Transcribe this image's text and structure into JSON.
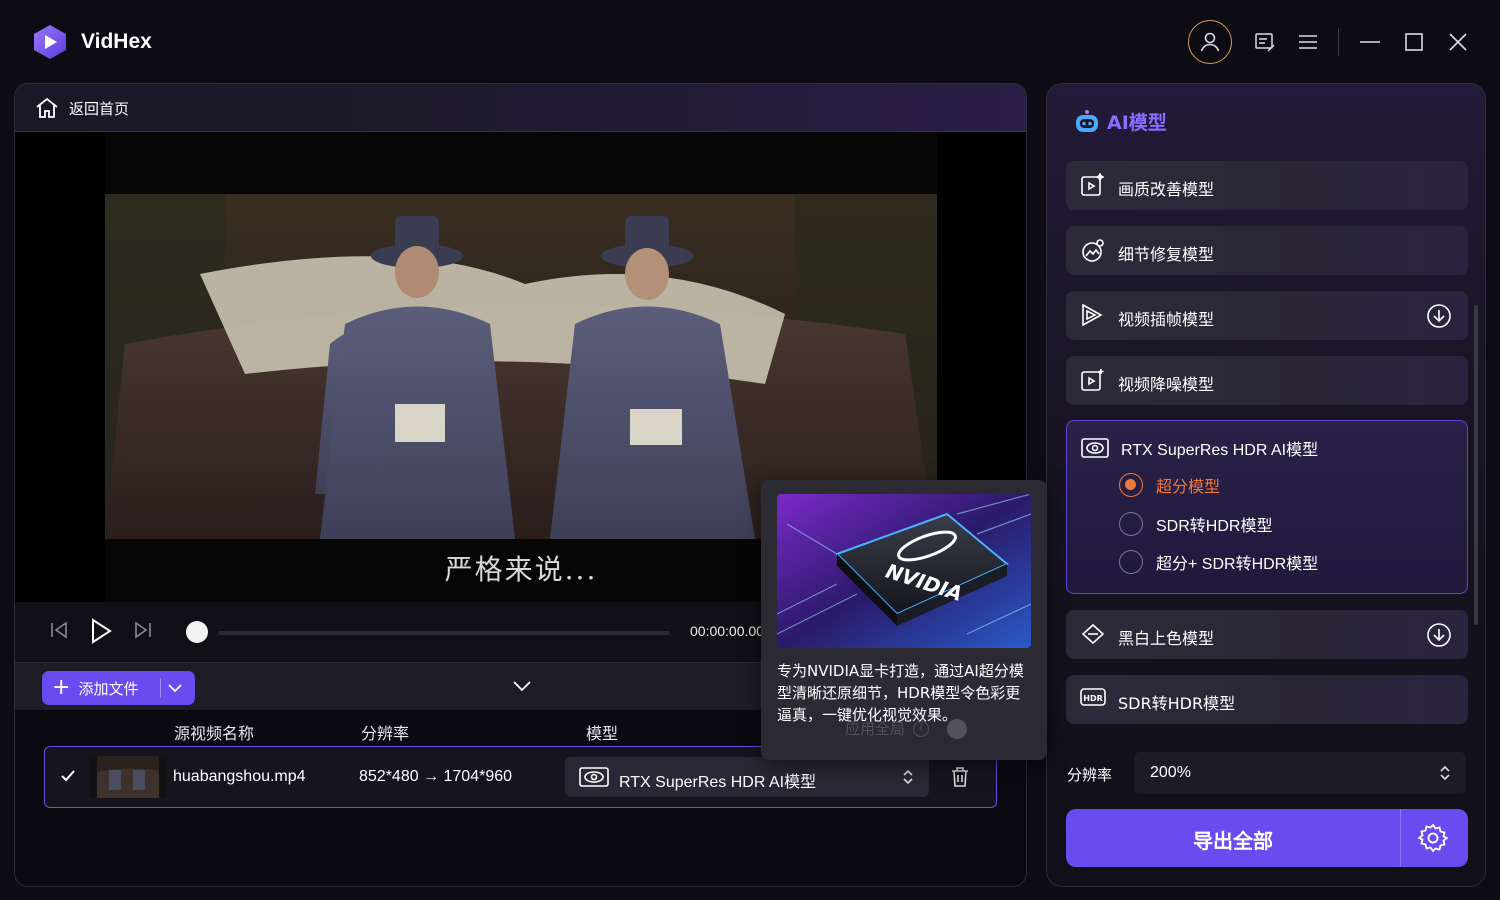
{
  "app": {
    "name": "VidHex"
  },
  "nav": {
    "home_label": "返回首页"
  },
  "video": {
    "subtitle": "严格来说...",
    "time": "00:00:00.00"
  },
  "toolbar": {
    "add_file_label": "添加文件"
  },
  "table": {
    "headers": {
      "name": "源视频名称",
      "resolution": "分辨率",
      "model": "模型"
    },
    "rows": [
      {
        "name": "huabangshou.mp4",
        "resolution": "852*480 → 1704*960",
        "model": "RTX SuperRes HDR AI模型"
      }
    ]
  },
  "sidebar": {
    "title": "AI模型",
    "models": [
      {
        "label": "画质改善模型",
        "icon": "enhance-icon",
        "download": false
      },
      {
        "label": "细节修复模型",
        "icon": "detail-icon",
        "download": false
      },
      {
        "label": "视频插帧模型",
        "icon": "frame-interp-icon",
        "download": true
      },
      {
        "label": "视频降噪模型",
        "icon": "denoise-icon",
        "download": false
      }
    ],
    "rtx": {
      "label": "RTX SuperRes HDR AI模型",
      "options": [
        {
          "label": "超分模型",
          "selected": true
        },
        {
          "label": "SDR转HDR模型",
          "selected": false
        },
        {
          "label": "超分+ SDR转HDR模型",
          "selected": false
        }
      ]
    },
    "models_after": [
      {
        "label": "黑白上色模型",
        "icon": "colorize-icon",
        "download": true
      },
      {
        "label": "SDR转HDR模型",
        "icon": "hdr-icon",
        "download": false
      }
    ],
    "resolution_label": "分辨率",
    "resolution_value": "200%",
    "export_label": "导出全部"
  },
  "tooltip": {
    "brand": "NVIDIA",
    "text": "专为NVIDIA显卡打造，通过AI超分模型清晰还原细节，HDR模型令色彩更逼真，一键优化视觉效果。",
    "apply_all": "应用全局"
  },
  "colors": {
    "accent": "#6a4bf0",
    "selected": "#f07a3a",
    "title_purple": "#8a6cff"
  }
}
